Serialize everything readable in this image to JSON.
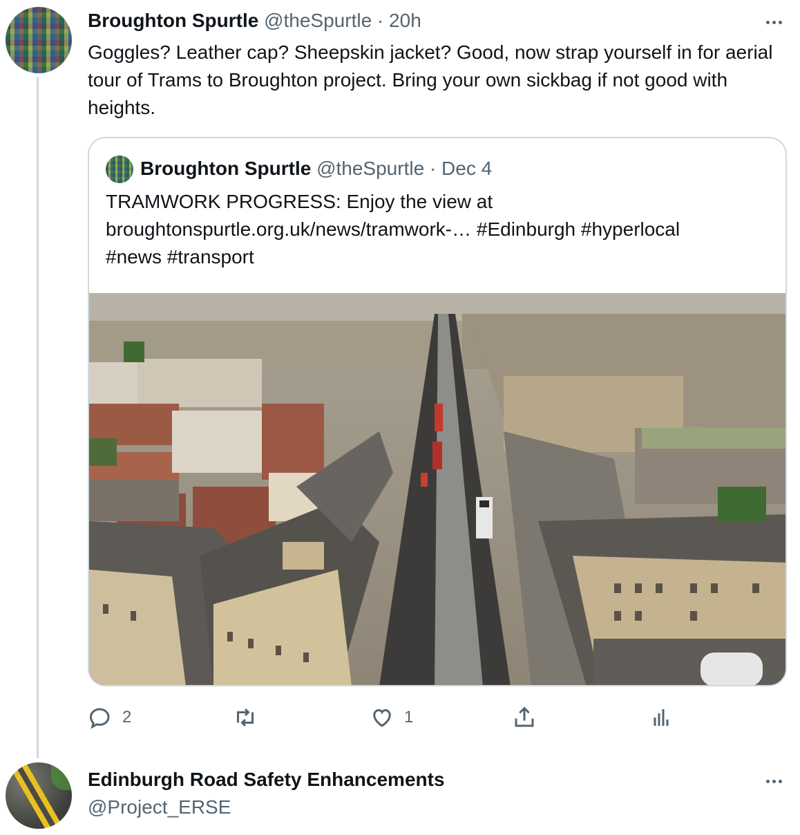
{
  "tweet": {
    "author_name": "Broughton Spurtle",
    "handle": "@theSpurtle",
    "separator": " · ",
    "time": "20h",
    "text": "Goggles? Leather cap? Sheepskin jacket? Good, now strap yourself in for aerial tour of Trams to Broughton project. Bring your own sickbag if not good with heights."
  },
  "quoted_tweet": {
    "author_name": "Broughton Spurtle",
    "handle": "@theSpurtle",
    "separator": " · ",
    "time": "Dec 4",
    "text_line1": "TRAMWORK PROGRESS: Enjoy the view at",
    "text_line2": "broughtonspurtle.org.uk/news/tramwork-… #Edinburgh #hyperlocal",
    "text_line3": "#news #transport"
  },
  "actions": {
    "reply_count": "2",
    "retweet_count": "",
    "like_count": "1"
  },
  "icons": {
    "reply": "reply-icon",
    "retweet": "retweet-icon",
    "like": "heart-icon",
    "share": "share-icon",
    "analytics": "analytics-icon",
    "more": "more-icon"
  },
  "next_tweet": {
    "author_name": "Edinburgh Road Safety Enhancements",
    "handle": "@Project_ERSE"
  },
  "colors": {
    "text_primary": "#0f1419",
    "text_secondary": "#536471",
    "border": "#cfd9de"
  }
}
